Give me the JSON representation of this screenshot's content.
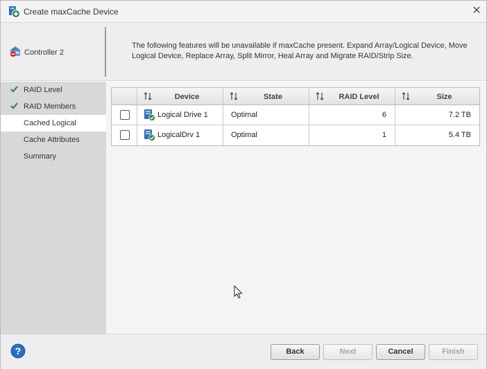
{
  "window": {
    "title": "Create maxCache Device"
  },
  "header": {
    "controller_label": "Controller 2",
    "message": "The following features will be unavailable if maxCache present. Expand Array/Logical Device, Move Logical Device, Replace Array, Split Mirror, Heal Array and Migrate RAID/Strip Size."
  },
  "sidebar": {
    "steps": [
      {
        "label": "RAID Level",
        "completed": true
      },
      {
        "label": "RAID Members",
        "completed": true
      },
      {
        "label": "Cached Logical",
        "active": true
      },
      {
        "label": "Cache Attributes"
      },
      {
        "label": "Summary"
      }
    ]
  },
  "table": {
    "columns": [
      "Device",
      "State",
      "RAID Level",
      "Size"
    ],
    "rows": [
      {
        "device": "Logical Drive 1",
        "state": "Optimal",
        "raid_level": "6",
        "size": "7.2 TB"
      },
      {
        "device": "LogicalDrv 1",
        "state": "Optimal",
        "raid_level": "1",
        "size": "5.4 TB"
      }
    ]
  },
  "footer": {
    "back_label": "Back",
    "next_label": "Next",
    "cancel_label": "Cancel",
    "finish_label": "Finish"
  },
  "colors": {
    "check_green": "#2e8b3a",
    "help_blue": "#1f5fa8",
    "sidebar_bg": "#d8d8d8"
  },
  "icons": {
    "title": "add-device-icon",
    "controller": "controller-icon",
    "sort": "sort-updown-icon",
    "drive": "logical-drive-ok-icon",
    "help": "help-icon",
    "close": "close-icon"
  }
}
